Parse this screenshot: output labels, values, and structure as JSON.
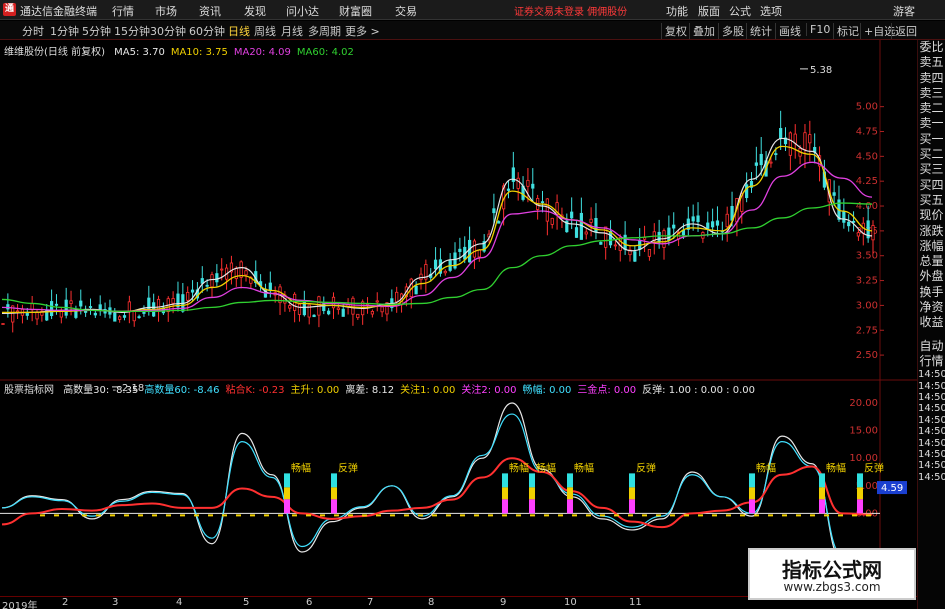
{
  "app": {
    "title": "通达信金融终端",
    "logo_char": "通",
    "menu": [
      "行情",
      "市场",
      "资讯",
      "发现",
      "问小达",
      "财富圈",
      "交易"
    ],
    "login_warning": "证券交易未登录 佣佣股份",
    "right_buttons": [
      "功能",
      "版面",
      "公式",
      "选项"
    ],
    "guest_label": "游客",
    "win_controls": [
      "▾",
      "─",
      "□",
      "✕"
    ]
  },
  "toolbar": {
    "periods": [
      "分时",
      "1分钟",
      "5分钟",
      "15分钟",
      "30分钟",
      "60分钟",
      "日线",
      "周线",
      "月线",
      "多周期",
      "更多 >"
    ],
    "active_period": "日线",
    "tools": [
      "复权",
      "叠加",
      "多股",
      "统计",
      "画线",
      "F10",
      "标记",
      "+自选",
      "返回"
    ]
  },
  "main_legend": {
    "stock": "维维股份(日线 前复权)",
    "ma": [
      {
        "label": "MA5: 3.70",
        "color": "#e6e6e6"
      },
      {
        "label": "MA10: 3.75",
        "color": "#f0d000"
      },
      {
        "label": "MA20: 4.09",
        "color": "#e040e0"
      },
      {
        "label": "MA60: 4.02",
        "color": "#30d030"
      }
    ]
  },
  "indicator_legend": {
    "name": "股票指标网",
    "items": [
      {
        "label": "高数量30: -8.35",
        "color": "#e6e6e6"
      },
      {
        "label": "高数量60: -8.46",
        "color": "#40e0ff"
      },
      {
        "label": "粘合K: -0.23",
        "color": "#ff3030"
      },
      {
        "label": "主升: 0.00",
        "color": "#f0d000"
      },
      {
        "label": "离差: 8.12",
        "color": "#e6e6e6"
      },
      {
        "label": "关注1: 0.00",
        "color": "#f0d000"
      },
      {
        "label": "关注2: 0.00",
        "color": "#ff40ff"
      },
      {
        "label": "畅幅: 0.00",
        "color": "#40e0ff"
      },
      {
        "label": "三金点: 0.00",
        "color": "#ff40ff"
      },
      {
        "label": "反弹: 1.00 : 0.00 : 0.00",
        "color": "#e6e6e6"
      }
    ]
  },
  "side_panel": {
    "top": [
      "委比",
      "卖五",
      "卖四",
      "卖三",
      "卖二",
      "卖一",
      "买一",
      "买二",
      "买三",
      "买四",
      "买五",
      "现价",
      "涨跌",
      "涨幅",
      "总量",
      "外盘",
      "换手",
      "净资",
      "收益"
    ],
    "bottom": [
      "自动",
      "行情",
      "14:50",
      "14:50",
      "14:50",
      "14:50",
      "14:50",
      "14:50",
      "14:50",
      "14:50",
      "14:50",
      "14:50"
    ]
  },
  "price_axis": [
    "5.00",
    "4.75",
    "4.50",
    "4.25",
    "4.00",
    "3.75",
    "3.50",
    "3.25",
    "3.00",
    "2.75",
    "2.50"
  ],
  "indicator_axis": [
    "20.00",
    "15.00",
    "10.00",
    "5.00",
    "0.00"
  ],
  "current_value_badge": "4.59",
  "annotations": {
    "high": "5.38",
    "low": "2.18",
    "signals": [
      "畅幅",
      "反弹",
      "畅幅",
      "畅幅",
      "畅幅",
      "反弹",
      "畅幅",
      "畅幅",
      "反弹"
    ]
  },
  "date_axis": [
    "2019年",
    "2",
    "3",
    "4",
    "5",
    "6",
    "7",
    "8",
    "9",
    "10",
    "11"
  ],
  "watermark": {
    "title": "指标公式网",
    "url": "www.zbgs3.com"
  },
  "colors": {
    "up": "#ff3030",
    "down": "#40e0e0",
    "ma5": "#e6e6e6",
    "ma10": "#f0d000",
    "ma20": "#e040e0",
    "ma60": "#30d030",
    "background": "#000000"
  },
  "chart_data": {
    "type": "line",
    "title": "维维股份(日线 前复权)",
    "ylim": [
      2.35,
      5.55
    ],
    "series": [
      {
        "name": "MA5",
        "values": [
          2.92,
          2.93,
          2.95,
          2.96,
          2.93,
          2.98,
          3.02,
          3.26,
          3.38,
          3.12,
          2.98,
          3.0,
          2.97,
          3.02,
          3.28,
          3.46,
          3.62,
          4.27,
          4.0,
          3.82,
          3.73,
          3.55,
          3.67,
          3.82,
          3.72,
          4.27,
          4.68,
          4.55,
          3.87,
          3.7
        ]
      },
      {
        "name": "MA10",
        "values": [
          2.93,
          2.93,
          2.94,
          2.95,
          2.94,
          2.96,
          3.0,
          3.18,
          3.3,
          3.15,
          3.02,
          3.0,
          2.98,
          3.0,
          3.22,
          3.4,
          3.56,
          4.15,
          4.02,
          3.86,
          3.76,
          3.6,
          3.64,
          3.78,
          3.75,
          4.2,
          4.6,
          4.52,
          3.95,
          3.75
        ]
      },
      {
        "name": "MA20",
        "values": [
          2.98,
          2.96,
          2.95,
          2.95,
          2.94,
          2.95,
          2.97,
          3.08,
          3.18,
          3.12,
          3.05,
          3.02,
          3.0,
          2.99,
          3.1,
          3.28,
          3.48,
          3.92,
          3.95,
          3.86,
          3.78,
          3.66,
          3.62,
          3.7,
          3.72,
          3.96,
          4.3,
          4.44,
          4.28,
          4.09
        ]
      },
      {
        "name": "MA60",
        "values": [
          3.06,
          3.02,
          2.98,
          2.95,
          2.94,
          2.94,
          2.95,
          2.98,
          3.03,
          3.05,
          3.04,
          3.03,
          3.02,
          3.01,
          3.02,
          3.08,
          3.16,
          3.38,
          3.5,
          3.6,
          3.65,
          3.68,
          3.7,
          3.7,
          3.72,
          3.78,
          3.88,
          3.98,
          4.03,
          4.02
        ]
      }
    ],
    "indicator": {
      "ylim": [
        -7,
        22
      ],
      "series": [
        {
          "name": "高数量30",
          "values": [
            1.0,
            3.2,
            2.5,
            -1.0,
            2.5,
            4.0,
            3.6,
            -5.5,
            14.5,
            7.0,
            -7.0,
            -1.5,
            1.0,
            5.0,
            -1.0,
            3.0,
            10.0,
            20.0,
            8.0,
            3.0,
            -1.0,
            -3.0,
            -1.0,
            7.5,
            3.0,
            -0.5,
            14.0,
            9.0,
            -8.5,
            -8.35
          ]
        },
        {
          "name": "高数量60",
          "values": [
            1.0,
            3.0,
            2.3,
            -0.5,
            2.2,
            3.8,
            3.4,
            -4.5,
            13.0,
            6.5,
            -6.0,
            -1.0,
            1.2,
            5.0,
            -0.5,
            3.2,
            10.5,
            18.0,
            7.5,
            3.5,
            -0.5,
            -2.5,
            -0.5,
            7.0,
            3.0,
            0.0,
            13.0,
            8.5,
            -7.5,
            -8.46
          ]
        },
        {
          "name": "粘合K",
          "values": [
            -2.0,
            0.0,
            0.8,
            0.5,
            1.5,
            1.8,
            1.0,
            1.0,
            4.5,
            3.0,
            0.0,
            -1.0,
            -0.5,
            0.5,
            1.0,
            2.5,
            6.5,
            10.0,
            7.5,
            4.0,
            1.0,
            -1.5,
            -2.5,
            0.0,
            0.5,
            2.0,
            7.0,
            8.5,
            0.0,
            -0.23
          ]
        }
      ]
    },
    "xlabel": "",
    "ylabel": ""
  }
}
